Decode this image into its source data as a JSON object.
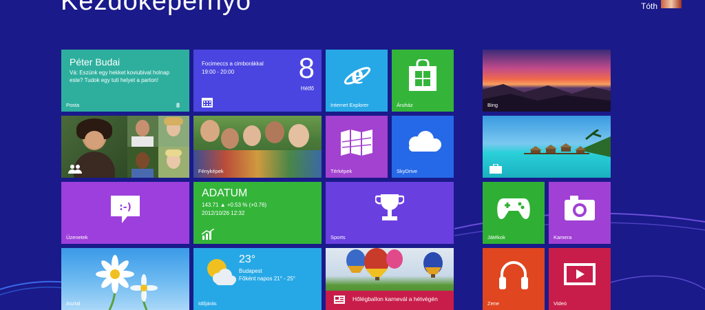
{
  "screen": {
    "title": "Kezdőképernyő",
    "user_name": "Tóth"
  },
  "tiles": {
    "mail": {
      "sender": "Péter Budai",
      "message": "Vá: Eszünk egy hekket koviubival holnap este? Tudok egy tuti helyet a parton!",
      "label": "Posta",
      "count": "8"
    },
    "calendar": {
      "event": "Focimeccs a cimborákkal",
      "time": "19:00 - 20:00",
      "day_number": "8",
      "day_name": "Hétfő"
    },
    "ie": {
      "label": "Internet Explorer"
    },
    "store": {
      "label": "Áruház"
    },
    "bing": {
      "label": "Bing"
    },
    "photos": {
      "label": "Fényképek"
    },
    "maps": {
      "label": "Térképek"
    },
    "skydrive": {
      "label": "SkyDrive"
    },
    "messaging": {
      "label": "Üzenetek"
    },
    "finance": {
      "ticker": "ADATUM",
      "quote": "143.71 ▲ +0.53 % (+0.76)",
      "date": "2012/10/26 12:32"
    },
    "sports": {
      "label": "Sports"
    },
    "games": {
      "label": "Játékok"
    },
    "camera": {
      "label": "Kamera"
    },
    "desktop": {
      "label": "Asztal"
    },
    "weather": {
      "temperature": "23°",
      "city": "Budapest",
      "forecast": "Főként napos 21° - 25°",
      "label": "Időjárás"
    },
    "travel": {
      "headline": "Hőlégballon karnevál a hétvégén"
    },
    "music": {
      "label": "Zene"
    },
    "video": {
      "label": "Videó"
    }
  },
  "colors": {
    "background": "#1a1a8a",
    "mail": "#2eaf9e",
    "calendar": "#4a45e0",
    "ie": "#27a8e6",
    "store": "#34b53a",
    "maps": "#a341d0",
    "skydrive": "#2669e8",
    "messaging": "#9d3fdc",
    "finance": "#34b53a",
    "sports": "#6a3fe0",
    "games": "#2fb034",
    "camera": "#a040d4",
    "weather": "#27a8e6",
    "music": "#e0461f",
    "video": "#c81d4a"
  }
}
